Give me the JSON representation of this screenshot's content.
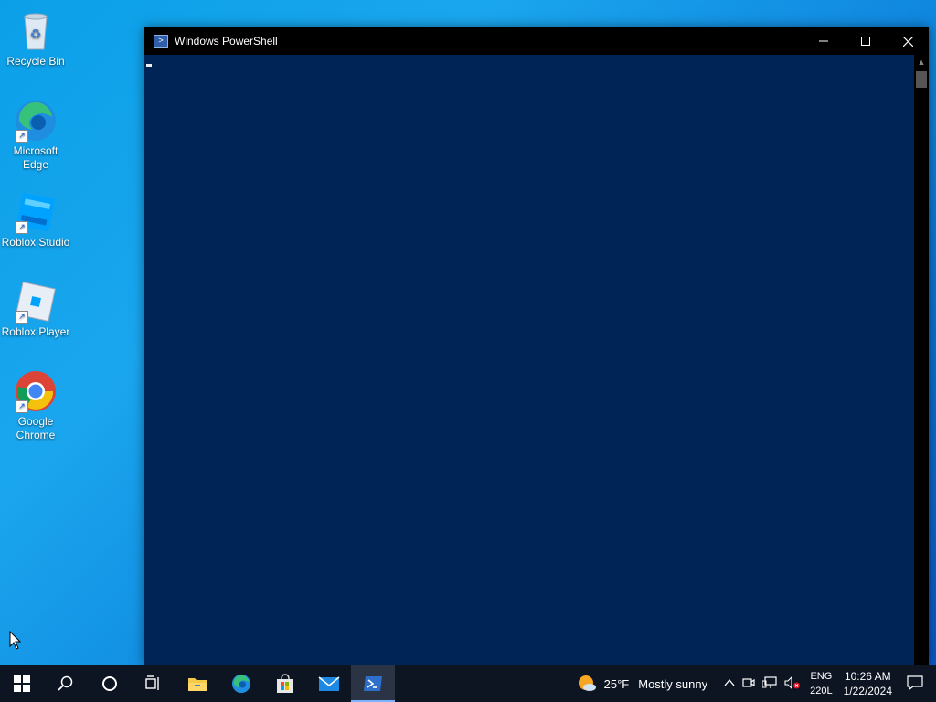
{
  "desktop": {
    "icons": [
      {
        "label": "Recycle Bin",
        "icon": "recycle-bin-icon"
      },
      {
        "label": "Microsoft Edge",
        "icon": "edge-icon"
      },
      {
        "label": "Roblox Studio",
        "icon": "roblox-studio-icon"
      },
      {
        "label": "Roblox Player",
        "icon": "roblox-player-icon"
      },
      {
        "label": "Google Chrome",
        "icon": "chrome-icon"
      }
    ]
  },
  "window": {
    "title": "Windows PowerShell",
    "minimize": "—",
    "maximize": "☐",
    "close": "✕",
    "background": "#012456"
  },
  "taskbar": {
    "weather": {
      "temp": "25°F",
      "condition": "Mostly sunny"
    },
    "language": {
      "line1": "ENG",
      "line2": "220L"
    },
    "clock": {
      "time": "10:26 AM",
      "date": "1/22/2024"
    }
  }
}
